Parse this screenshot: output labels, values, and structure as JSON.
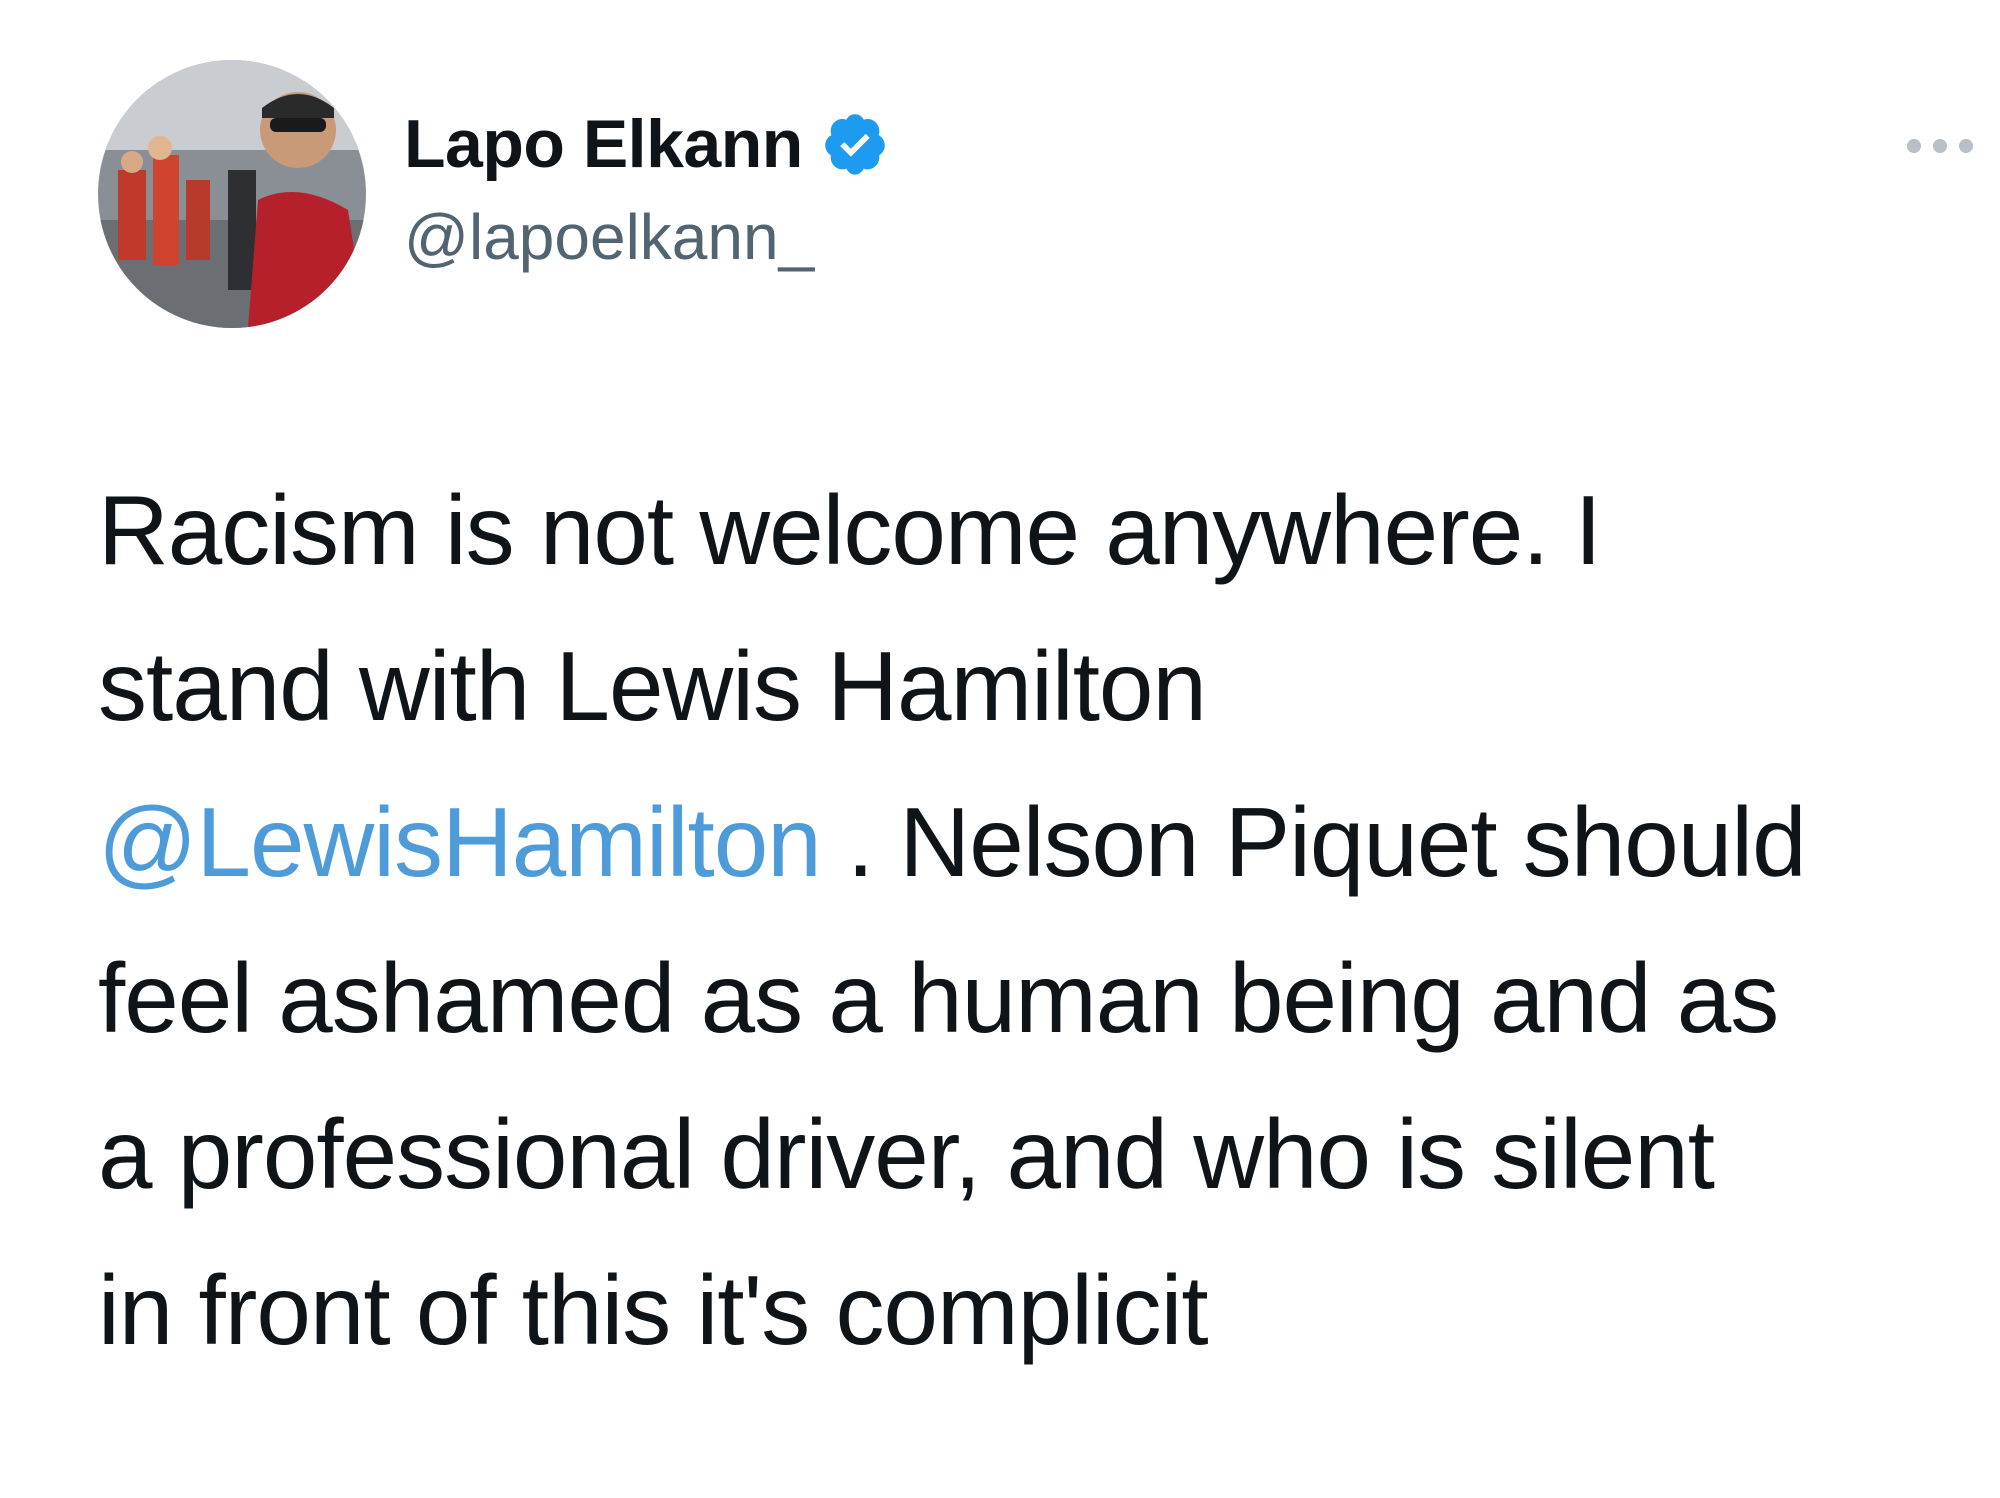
{
  "author": {
    "display_name": "Lapo Elkann",
    "handle": "@lapoelkann_",
    "verified": true,
    "avatar_icon": "avatar-photo",
    "verified_icon": "verified-badge-icon",
    "verified_color": "#1d9bf0"
  },
  "more_icon": "more-options-icon",
  "tweet": {
    "line1": "Racism is not welcome anywhere. I",
    "line2": "stand with Lewis Hamilton",
    "mention": "@LewisHamilton",
    "line3_rest": " . Nelson Piquet should",
    "line4": "feel ashamed as a human being and as",
    "line5": "a professional driver, and who is silent",
    "line6": "in front of this it's complicit",
    "mention_color": "#4d9bd8"
  }
}
